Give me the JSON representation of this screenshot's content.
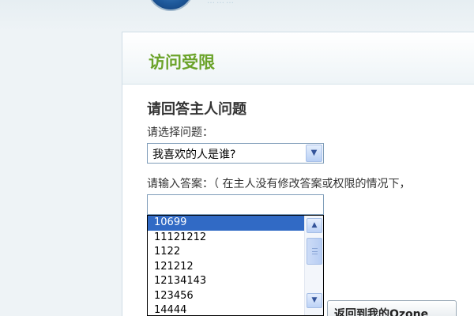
{
  "header": {
    "logo_text": "………"
  },
  "panel": {
    "title": "访问受限"
  },
  "form": {
    "section_title": "请回答主人问题",
    "question_label": "请选择问题：",
    "question_selected": "我喜欢的人是谁?",
    "answer_label": "请输入答案：（ 在主人没有修改答案或权限的情况下，",
    "answer_value": "",
    "autocomplete_items": [
      "10699",
      "11121212",
      "1122",
      "121212",
      "12134143",
      "123456",
      "14444"
    ],
    "autocomplete_selected_index": 0,
    "return_button_label": "返回到我的Ozone"
  },
  "icons": {
    "select_arrow": "chevron-down-icon",
    "scroll_up": "chevron-up-icon",
    "scroll_down": "chevron-down-icon",
    "logo": "globe-logo-icon"
  },
  "colors": {
    "title_green": "#6ba32a",
    "selection_blue": "#316ac5",
    "border_blue": "#7f9db9"
  }
}
